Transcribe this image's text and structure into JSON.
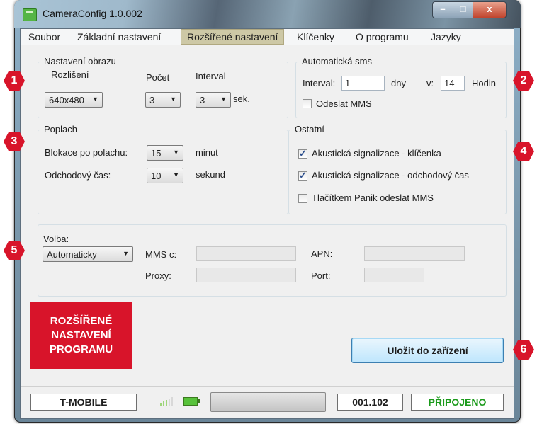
{
  "window": {
    "title": "CameraConfig 1.0.002",
    "min": "–",
    "max": "□",
    "close": "x"
  },
  "menu": {
    "items": [
      "Soubor",
      "Základní nastavení",
      "Rozšířené nastavení",
      "Klíčenky",
      "O programu",
      "Jazyky"
    ],
    "active": "Rozšířené nastavení"
  },
  "image_settings": {
    "title": "Nastavení obrazu",
    "resolution_label": "Rozlišení",
    "resolution_value": "640x480",
    "count_label": "Počet",
    "count_value": "3",
    "interval_label": "Interval",
    "interval_value": "3",
    "interval_unit": "sek."
  },
  "auto_sms": {
    "title": "Automatická sms",
    "interval_label": "Interval:",
    "interval_value": "1",
    "days_label": "dny",
    "at_label": "v:",
    "hour_value": "14",
    "hour_label": "Hodin",
    "send_mms_label": "Odeslat MMS",
    "send_mms_checked": false
  },
  "alarm": {
    "title": "Poplach",
    "block_label": "Blokace po polachu:",
    "block_value": "15",
    "block_unit": "minut",
    "exit_label": "Odchodový čas:",
    "exit_value": "10",
    "exit_unit": "sekund"
  },
  "other": {
    "title": "Ostatní",
    "options": [
      {
        "label": "Akustická signalizace - klíčenka",
        "checked": true
      },
      {
        "label": "Akustická signalizace - odchodový čas",
        "checked": true
      },
      {
        "label": "Tlačítkem Panik odeslat MMS",
        "checked": false
      }
    ]
  },
  "mms": {
    "choice_label": "Volba:",
    "choice_value": "Automaticky",
    "mmsc_label": "MMS c:",
    "proxy_label": "Proxy:",
    "apn_label": "APN:",
    "port_label": "Port:"
  },
  "promo": {
    "lines": [
      "ROZŠÍŘENÉ",
      "NASTAVENÍ",
      "PROGRAMU"
    ]
  },
  "save_button": "Uložit do zařízení",
  "status": {
    "operator": "T-MOBILE",
    "version": "001.102",
    "connection": "PŘIPOJENO",
    "connection_color": "#1a9a1a"
  },
  "callouts": [
    "1",
    "2",
    "3",
    "4",
    "5",
    "6"
  ],
  "colors": {
    "callout": "#d8142a",
    "menu_active": "#cdc8a6"
  }
}
